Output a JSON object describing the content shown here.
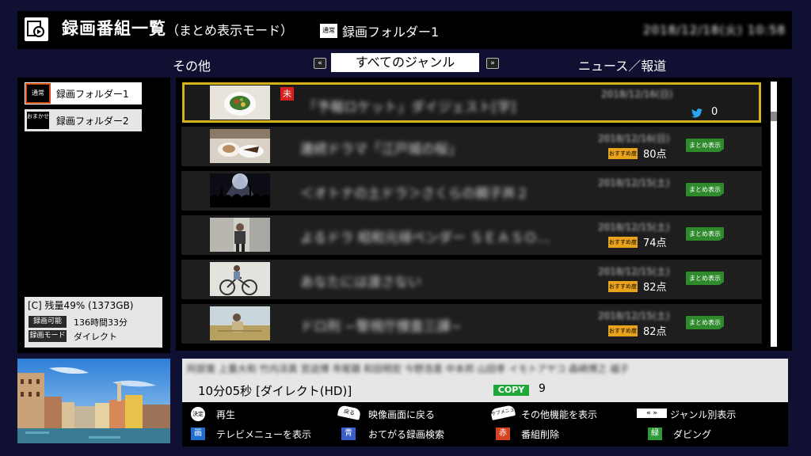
{
  "header": {
    "title": "録画番組一覧",
    "subtitle": "（まとめ表示モード）",
    "folder_badge": "通常",
    "folder_name": "録画フォルダー1",
    "datetime": "2018/12/18(火) 10:58"
  },
  "genre": {
    "left": "その他",
    "center": "すべてのジャンル",
    "right": "ニュース／報道",
    "arrow_left": "«",
    "arrow_right": "»"
  },
  "folders": [
    {
      "icon_text": "通常",
      "label": "録画フォルダー1"
    },
    {
      "icon_text": "おまかせ",
      "label": "録画フォルダー2"
    }
  ],
  "storage": {
    "summary": "[C] 残量49% (1373GB)",
    "rec_avail_tag": "録画可能",
    "rec_avail_value": "136時間33分",
    "rec_mode_tag": "録画モード",
    "rec_mode_value": "ダイレクト"
  },
  "list": [
    {
      "title": "「予報ロケット」ダイジェスト[字]",
      "date": "2018/12/16(日)",
      "unseen": "未",
      "twitter_count": "0"
    },
    {
      "title": "連続ドラマ「江戸城の桜」",
      "date": "2018/12/16(日)",
      "rec_badge": "おすすめ度",
      "score": "80点",
      "summary": "まとめ表示"
    },
    {
      "title": "＜オトナの土ドラ＞さくらの親子丼２",
      "date": "2018/12/15(土)",
      "summary": "まとめ表示"
    },
    {
      "title": "よるドラ 昭和元禄ペンダー ＳＥＡＳＯ…",
      "date": "2018/12/15(土)",
      "rec_badge": "おすすめ度",
      "score": "74点",
      "summary": "まとめ表示"
    },
    {
      "title": "あなたには渡さない",
      "date": "2018/12/15(土)",
      "rec_badge": "おすすめ度",
      "score": "82点",
      "summary": "まとめ表示"
    },
    {
      "title": "ドロ刑 −警視庁捜査三課−",
      "date": "2018/12/15(土)",
      "rec_badge": "おすすめ度",
      "score": "82点",
      "summary": "まとめ表示"
    }
  ],
  "detail": {
    "cast": "阿部寛 上重大和 竹内涼真 宮迫博 寺尾聰 和田明宏 今野浩喜 中本邦 山田孝 イモトアヤコ 森崎博之 福子",
    "duration": "10分05秒 [ダイレクト(HD)]",
    "copy_label": "COPY",
    "copy_count": "9"
  },
  "help": {
    "play_icon": "決定",
    "play": "再生",
    "back_icon": "戻る",
    "back": "映像画面に戻る",
    "other_icon": "サブメニュー",
    "other": "その他機能を表示",
    "genre_icon": "« »",
    "genre": "ジャンル別表示",
    "tvmenu_icon": "画",
    "tvmenu": "テレビメニューを表示",
    "blue_icon": "青",
    "blue": "おてがる録画検索",
    "red_icon": "赤",
    "red": "番組削除",
    "green_icon": "緑",
    "green": "ダビング"
  },
  "colors": {
    "selection": "#d4b21c",
    "copy": "#1ea838",
    "summary": "#2e8a2b",
    "badge_orange": "#e9a21c",
    "unseen_red": "#d6201f"
  }
}
